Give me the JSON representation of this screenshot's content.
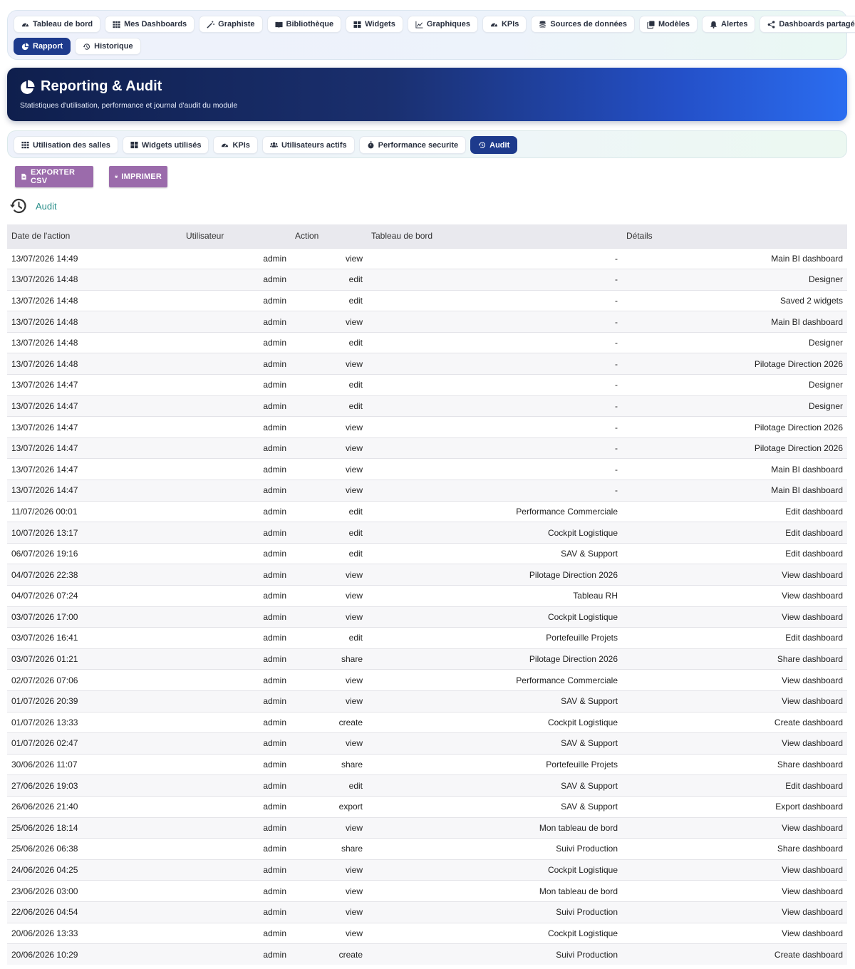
{
  "topnav": {
    "row1": [
      {
        "label": "Tableau de bord",
        "icon": "gauge-icon"
      },
      {
        "label": "Mes Dashboards",
        "icon": "grid-icon"
      },
      {
        "label": "Graphiste",
        "icon": "magic-wand-icon"
      },
      {
        "label": "Bibliothèque",
        "icon": "book-icon"
      },
      {
        "label": "Widgets",
        "icon": "widgets-icon"
      },
      {
        "label": "Graphiques",
        "icon": "chart-icon"
      },
      {
        "label": "KPIs",
        "icon": "gauge-icon"
      },
      {
        "label": "Sources de données",
        "icon": "database-icon"
      },
      {
        "label": "Modèles",
        "icon": "copy-icon"
      },
      {
        "label": "Alertes",
        "icon": "bell-icon"
      },
      {
        "label": "Dashboards partagés",
        "icon": "share-icon"
      }
    ],
    "row2": [
      {
        "label": "Rapport",
        "icon": "pie-chart-icon",
        "active": true
      },
      {
        "label": "Historique",
        "icon": "history-icon"
      }
    ]
  },
  "hero": {
    "title": "Reporting & Audit",
    "subtitle": "Statistiques d'utilisation, performance et journal d'audit du module"
  },
  "subnav": [
    {
      "label": "Utilisation des salles",
      "icon": "grid-icon"
    },
    {
      "label": "Widgets utilisés",
      "icon": "widgets-icon"
    },
    {
      "label": "KPIs",
      "icon": "gauge-icon"
    },
    {
      "label": "Utilisateurs actifs",
      "icon": "users-icon"
    },
    {
      "label": "Performance securite",
      "icon": "stopwatch-icon"
    },
    {
      "label": "Audit",
      "icon": "history-icon",
      "active": true
    }
  ],
  "actions": {
    "export_csv": "EXPORTER CSV",
    "print": "IMPRIMER"
  },
  "section": {
    "title": "Audit"
  },
  "table": {
    "columns": [
      "Date de l'action",
      "Utilisateur",
      "Action",
      "Tableau de bord",
      "Détails"
    ],
    "rows": [
      [
        "13/07/2026 14:49",
        "admin",
        "view",
        "-",
        "Main BI dashboard"
      ],
      [
        "13/07/2026 14:48",
        "admin",
        "edit",
        "-",
        "Designer"
      ],
      [
        "13/07/2026 14:48",
        "admin",
        "edit",
        "-",
        "Saved 2 widgets"
      ],
      [
        "13/07/2026 14:48",
        "admin",
        "view",
        "-",
        "Main BI dashboard"
      ],
      [
        "13/07/2026 14:48",
        "admin",
        "edit",
        "-",
        "Designer"
      ],
      [
        "13/07/2026 14:48",
        "admin",
        "view",
        "-",
        "Pilotage Direction 2026"
      ],
      [
        "13/07/2026 14:47",
        "admin",
        "edit",
        "-",
        "Designer"
      ],
      [
        "13/07/2026 14:47",
        "admin",
        "edit",
        "-",
        "Designer"
      ],
      [
        "13/07/2026 14:47",
        "admin",
        "view",
        "-",
        "Pilotage Direction 2026"
      ],
      [
        "13/07/2026 14:47",
        "admin",
        "view",
        "-",
        "Pilotage Direction 2026"
      ],
      [
        "13/07/2026 14:47",
        "admin",
        "view",
        "-",
        "Main BI dashboard"
      ],
      [
        "13/07/2026 14:47",
        "admin",
        "view",
        "-",
        "Main BI dashboard"
      ],
      [
        "11/07/2026 00:01",
        "admin",
        "edit",
        "Performance Commerciale",
        "Edit dashboard"
      ],
      [
        "10/07/2026 13:17",
        "admin",
        "edit",
        "Cockpit Logistique",
        "Edit dashboard"
      ],
      [
        "06/07/2026 19:16",
        "admin",
        "edit",
        "SAV & Support",
        "Edit dashboard"
      ],
      [
        "04/07/2026 22:38",
        "admin",
        "view",
        "Pilotage Direction 2026",
        "View dashboard"
      ],
      [
        "04/07/2026 07:24",
        "admin",
        "view",
        "Tableau RH",
        "View dashboard"
      ],
      [
        "03/07/2026 17:00",
        "admin",
        "view",
        "Cockpit Logistique",
        "View dashboard"
      ],
      [
        "03/07/2026 16:41",
        "admin",
        "edit",
        "Portefeuille Projets",
        "Edit dashboard"
      ],
      [
        "03/07/2026 01:21",
        "admin",
        "share",
        "Pilotage Direction 2026",
        "Share dashboard"
      ],
      [
        "02/07/2026 07:06",
        "admin",
        "view",
        "Performance Commerciale",
        "View dashboard"
      ],
      [
        "01/07/2026 20:39",
        "admin",
        "view",
        "SAV & Support",
        "View dashboard"
      ],
      [
        "01/07/2026 13:33",
        "admin",
        "create",
        "Cockpit Logistique",
        "Create dashboard"
      ],
      [
        "01/07/2026 02:47",
        "admin",
        "view",
        "SAV & Support",
        "View dashboard"
      ],
      [
        "30/06/2026 11:07",
        "admin",
        "share",
        "Portefeuille Projets",
        "Share dashboard"
      ],
      [
        "27/06/2026 19:03",
        "admin",
        "edit",
        "SAV & Support",
        "Edit dashboard"
      ],
      [
        "26/06/2026 21:40",
        "admin",
        "export",
        "SAV & Support",
        "Export dashboard"
      ],
      [
        "25/06/2026 18:14",
        "admin",
        "view",
        "Mon tableau de bord",
        "View dashboard"
      ],
      [
        "25/06/2026 06:38",
        "admin",
        "share",
        "Suivi Production",
        "Share dashboard"
      ],
      [
        "24/06/2026 04:25",
        "admin",
        "view",
        "Cockpit Logistique",
        "View dashboard"
      ],
      [
        "23/06/2026 03:00",
        "admin",
        "view",
        "Mon tableau de bord",
        "View dashboard"
      ],
      [
        "22/06/2026 04:54",
        "admin",
        "view",
        "Suivi Production",
        "View dashboard"
      ],
      [
        "20/06/2026 13:33",
        "admin",
        "view",
        "Cockpit Logistique",
        "View dashboard"
      ],
      [
        "20/06/2026 10:29",
        "admin",
        "create",
        "Suivi Production",
        "Create dashboard"
      ]
    ]
  },
  "colors": {
    "accent_button": "#9b6bab",
    "active_pill": "#1d3a8c",
    "section_title": "#2a8f8a",
    "hero_start": "#0f1f4d",
    "hero_end": "#2b6df0"
  }
}
